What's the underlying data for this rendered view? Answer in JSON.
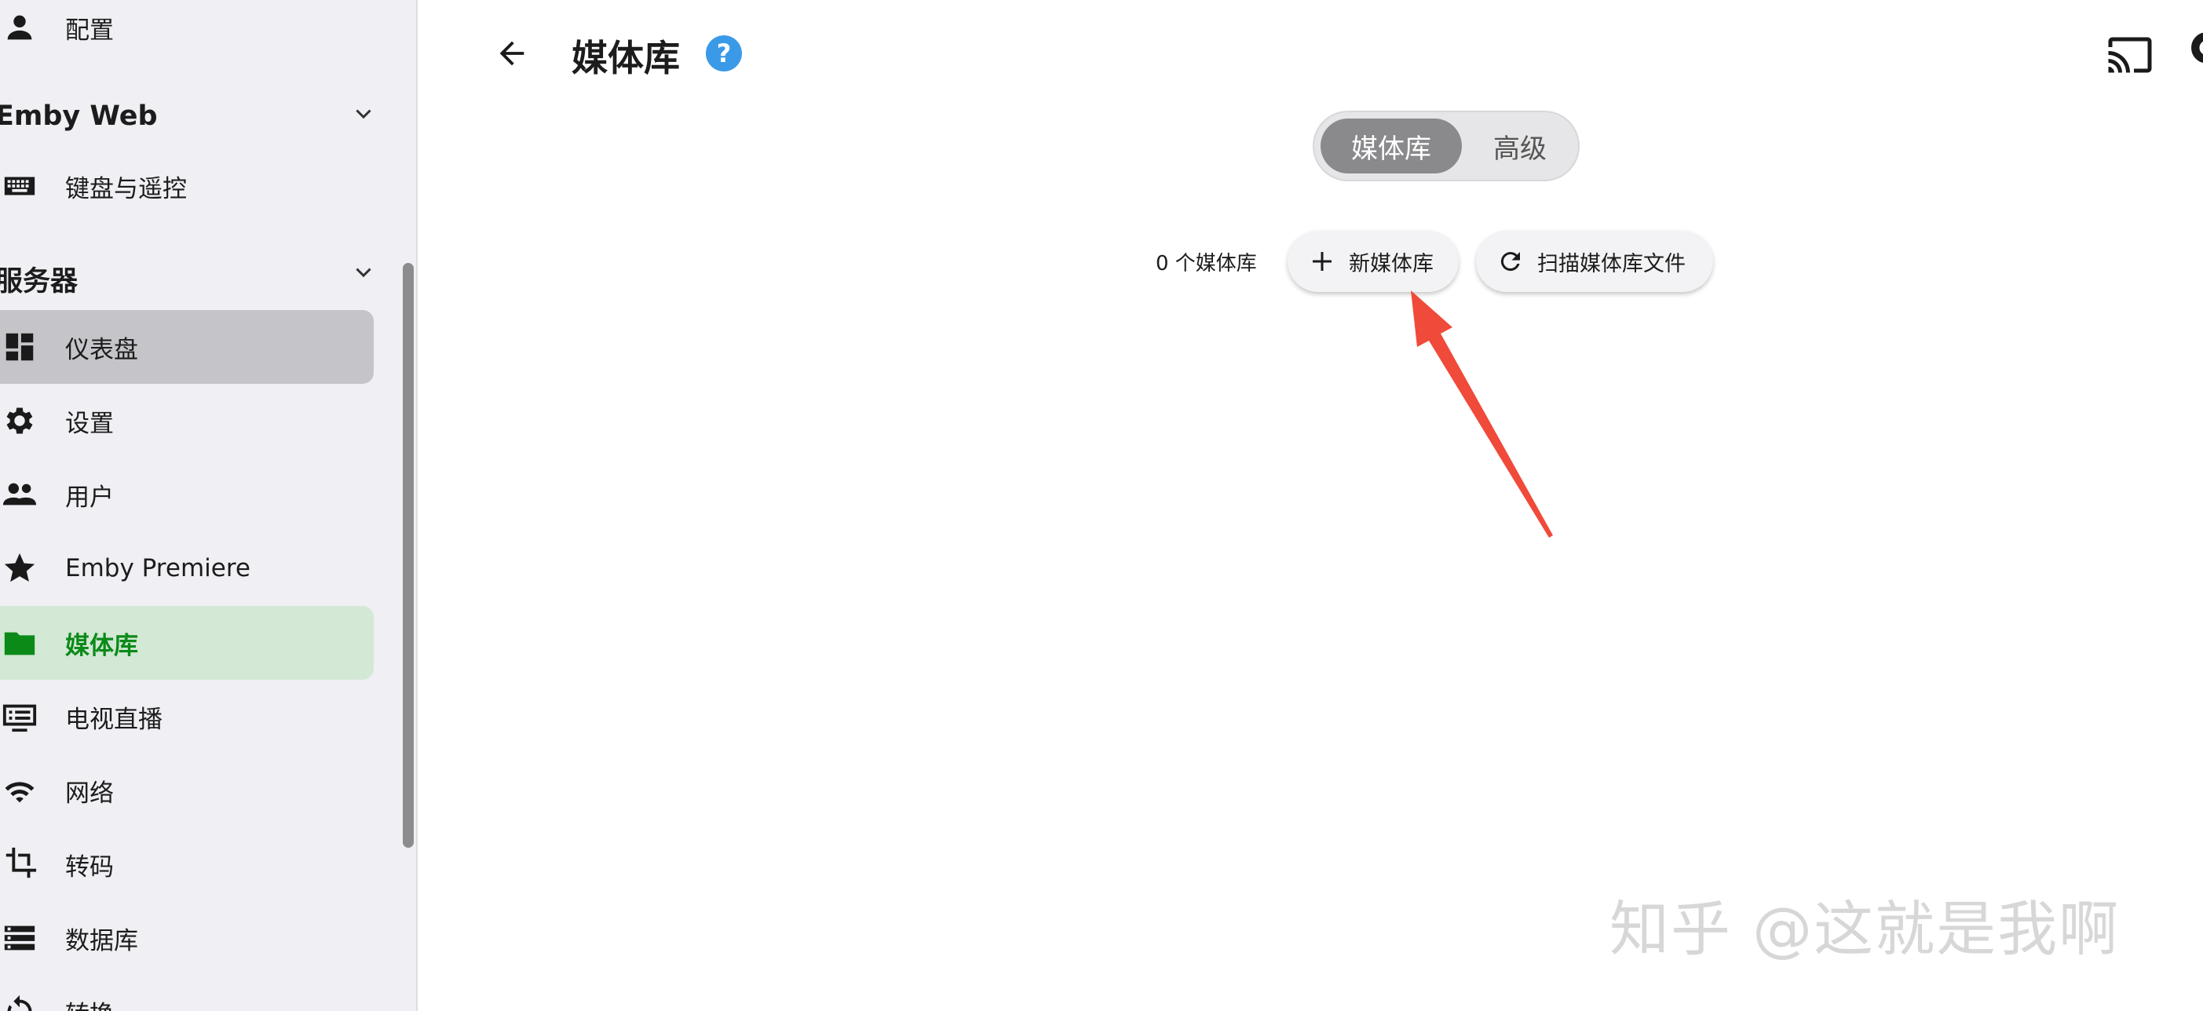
{
  "sidebar": {
    "items_top": [
      {
        "label": "配置",
        "icon": "person-icon"
      }
    ],
    "sections": [
      {
        "title": "Emby Web",
        "items": [
          {
            "label": "键盘与遥控",
            "icon": "keyboard-icon"
          }
        ]
      },
      {
        "title": "服务器",
        "items": [
          {
            "label": "仪表盘",
            "icon": "dashboard-icon"
          },
          {
            "label": "设置",
            "icon": "gear-icon"
          },
          {
            "label": "用户",
            "icon": "people-icon"
          },
          {
            "label": "Emby Premiere",
            "icon": "star-icon"
          },
          {
            "label": "媒体库",
            "icon": "folder-icon",
            "active": true
          },
          {
            "label": "电视直播",
            "icon": "tv-icon"
          },
          {
            "label": "网络",
            "icon": "wifi-icon"
          },
          {
            "label": "转码",
            "icon": "crop-icon"
          },
          {
            "label": "数据库",
            "icon": "storage-icon"
          },
          {
            "label": "转换",
            "icon": "sync-icon"
          }
        ]
      }
    ]
  },
  "header": {
    "title": "媒体库",
    "help": "?"
  },
  "tabs": [
    {
      "label": "媒体库",
      "selected": true
    },
    {
      "label": "高级",
      "selected": false
    }
  ],
  "toolbar": {
    "count_text": "0 个媒体库",
    "new_library": "新媒体库",
    "scan_library": "扫描媒体库文件"
  },
  "watermark": "知乎 @这就是我啊",
  "colors": {
    "accent": "#0b8a18",
    "active_bg": "#d3e8d5",
    "hover_bg": "#c5c4c9",
    "sidebar_bg": "#f0eff4",
    "help": "#3a9ae8",
    "arrow": "#f04a3a"
  }
}
